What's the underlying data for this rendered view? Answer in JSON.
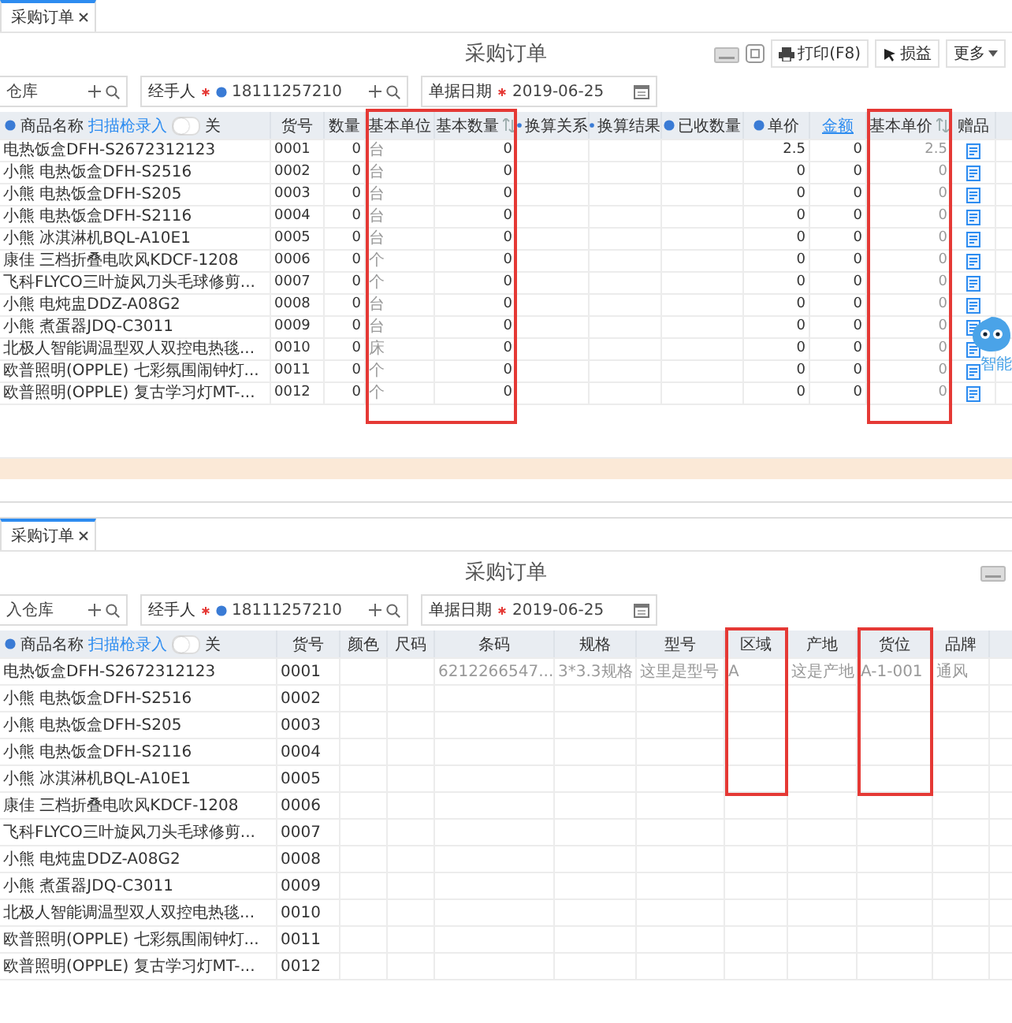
{
  "panels": [
    {
      "tab": {
        "label": "采购订单",
        "closable": true
      },
      "title": "采购订单",
      "toolbar": [
        {
          "kind": "keyboard"
        },
        {
          "kind": "fullscreen"
        },
        {
          "kind": "print",
          "label": "打印(F8)"
        },
        {
          "kind": "loss",
          "label": "损益"
        },
        {
          "kind": "more",
          "label": "更多"
        }
      ],
      "filters": [
        {
          "kind": "warehouse",
          "value": "仓库"
        },
        {
          "kind": "person",
          "label": "经手人",
          "required": true,
          "info": true,
          "value": "18111257210"
        },
        {
          "kind": "date",
          "label": "单据日期",
          "required": true,
          "value": "2019-06-25"
        }
      ],
      "columns": [
        {
          "kind": "name",
          "label": "商品名称",
          "info": true,
          "scan_link": "扫描枪录入",
          "toggle": {
            "label": "关",
            "on": false
          }
        },
        {
          "kind": "text",
          "label": "货号"
        },
        {
          "kind": "number",
          "label": "数量"
        },
        {
          "kind": "text",
          "label": "基本单位",
          "readonly": true,
          "highlighted": true
        },
        {
          "kind": "number",
          "label": "基本数量",
          "sortable": true,
          "highlighted": true
        },
        {
          "kind": "text",
          "label": "换算关系",
          "info": true
        },
        {
          "kind": "text",
          "label": "换算结果",
          "info": true
        },
        {
          "kind": "number",
          "label": "已收数量",
          "info": true
        },
        {
          "kind": "number",
          "label": "单价",
          "info": true
        },
        {
          "kind": "number",
          "label": "金额",
          "link": true
        },
        {
          "kind": "number",
          "label": "基本单价",
          "sortable": true,
          "readonly": true,
          "highlighted": true
        },
        {
          "kind": "icon",
          "label": "赠品"
        }
      ],
      "rows": [
        [
          "电热饭盒DFH-S2672312123",
          "0001",
          "0",
          "台",
          "0",
          null,
          null,
          null,
          "2.5",
          "0",
          "2.5",
          null
        ],
        [
          "小熊 电热饭盒DFH-S2516",
          "0002",
          "0",
          "台",
          "0",
          null,
          null,
          null,
          "0",
          "0",
          "0",
          null
        ],
        [
          "小熊 电热饭盒DFH-S205",
          "0003",
          "0",
          "台",
          "0",
          null,
          null,
          null,
          "0",
          "0",
          "0",
          null
        ],
        [
          "小熊 电热饭盒DFH-S2116",
          "0004",
          "0",
          "台",
          "0",
          null,
          null,
          null,
          "0",
          "0",
          "0",
          null
        ],
        [
          "小熊 冰淇淋机BQL-A10E1",
          "0005",
          "0",
          "台",
          "0",
          null,
          null,
          null,
          "0",
          "0",
          "0",
          null
        ],
        [
          "康佳 三档折叠电吹风KDCF-1208",
          "0006",
          "0",
          "个",
          "0",
          null,
          null,
          null,
          "0",
          "0",
          "0",
          null
        ],
        [
          "飞科FLYCO三叶旋风刀头毛球修剪...",
          "0007",
          "0",
          "个",
          "0",
          null,
          null,
          null,
          "0",
          "0",
          "0",
          null
        ],
        [
          "小熊 电炖盅DDZ-A08G2",
          "0008",
          "0",
          "台",
          "0",
          null,
          null,
          null,
          "0",
          "0",
          "0",
          null
        ],
        [
          "小熊 煮蛋器JDQ-C3011",
          "0009",
          "0",
          "台",
          "0",
          null,
          null,
          null,
          "0",
          "0",
          "0",
          null
        ],
        [
          "北极人智能调温型双人双控电热毯...",
          "0010",
          "0",
          "床",
          "0",
          null,
          null,
          null,
          "0",
          "0",
          "0",
          null
        ],
        [
          "欧普照明(OPPLE) 七彩氛围闹钟灯...",
          "0011",
          "0",
          "个",
          "0",
          null,
          null,
          null,
          "0",
          "0",
          "0",
          null
        ],
        [
          "欧普照明(OPPLE) 复古学习灯MT-...",
          "0012",
          "0",
          "个",
          "0",
          null,
          null,
          null,
          "0",
          "0",
          "0",
          null
        ]
      ],
      "summary_row": true,
      "highlight_full_height": true,
      "assistant": {
        "label": "智能"
      }
    },
    {
      "tab": {
        "label": "采购订单",
        "closable": true
      },
      "title": "采购订单",
      "toolbar": [
        {
          "kind": "keyboard"
        }
      ],
      "filters": [
        {
          "kind": "warehouse",
          "value": "入仓库"
        },
        {
          "kind": "person",
          "label": "经手人",
          "required": true,
          "info": true,
          "value": "18111257210"
        },
        {
          "kind": "date",
          "label": "单据日期",
          "required": true,
          "value": "2019-06-25"
        }
      ],
      "columns": [
        {
          "kind": "name",
          "label": "商品名称",
          "info": true,
          "scan_link": "扫描枪录入",
          "toggle": {
            "label": "关",
            "on": false
          }
        },
        {
          "kind": "text",
          "label": "货号"
        },
        {
          "kind": "text",
          "label": "颜色"
        },
        {
          "kind": "text",
          "label": "尺码"
        },
        {
          "kind": "text",
          "label": "条码",
          "readonly": true
        },
        {
          "kind": "text",
          "label": "规格",
          "readonly": true
        },
        {
          "kind": "text",
          "label": "型号",
          "readonly": true
        },
        {
          "kind": "text",
          "label": "区域",
          "readonly": true,
          "highlighted": true
        },
        {
          "kind": "text",
          "label": "产地",
          "readonly": true
        },
        {
          "kind": "text",
          "label": "货位",
          "readonly": true,
          "highlighted": true
        },
        {
          "kind": "text",
          "label": "品牌",
          "readonly": true
        }
      ],
      "rows": [
        [
          "电热饭盒DFH-S2672312123",
          "0001",
          null,
          null,
          "6212266547...",
          "3*3.3规格",
          "这里是型号",
          "A",
          "这是产地",
          "A-1-001",
          "通风"
        ],
        [
          "小熊 电热饭盒DFH-S2516",
          "0002",
          null,
          null,
          null,
          null,
          null,
          null,
          null,
          null,
          null
        ],
        [
          "小熊 电热饭盒DFH-S205",
          "0003",
          null,
          null,
          null,
          null,
          null,
          null,
          null,
          null,
          null
        ],
        [
          "小熊 电热饭盒DFH-S2116",
          "0004",
          null,
          null,
          null,
          null,
          null,
          null,
          null,
          null,
          null
        ],
        [
          "小熊 冰淇淋机BQL-A10E1",
          "0005",
          null,
          null,
          null,
          null,
          null,
          null,
          null,
          null,
          null
        ],
        [
          "康佳 三档折叠电吹风KDCF-1208",
          "0006",
          null,
          null,
          null,
          null,
          null,
          null,
          null,
          null,
          null
        ],
        [
          "飞科FLYCO三叶旋风刀头毛球修剪...",
          "0007",
          null,
          null,
          null,
          null,
          null,
          null,
          null,
          null,
          null
        ],
        [
          "小熊 电炖盅DDZ-A08G2",
          "0008",
          null,
          null,
          null,
          null,
          null,
          null,
          null,
          null,
          null
        ],
        [
          "小熊 煮蛋器JDQ-C3011",
          "0009",
          null,
          null,
          null,
          null,
          null,
          null,
          null,
          null,
          null
        ],
        [
          "北极人智能调温型双人双控电热毯...",
          "0010",
          null,
          null,
          null,
          null,
          null,
          null,
          null,
          null,
          null
        ],
        [
          "欧普照明(OPPLE) 七彩氛围闹钟灯...",
          "0011",
          null,
          null,
          null,
          null,
          null,
          null,
          null,
          null,
          null
        ],
        [
          "欧普照明(OPPLE) 复古学习灯MT-...",
          "0012",
          null,
          null,
          null,
          null,
          null,
          null,
          null,
          null,
          null
        ]
      ],
      "highlight_full_height": false
    }
  ]
}
